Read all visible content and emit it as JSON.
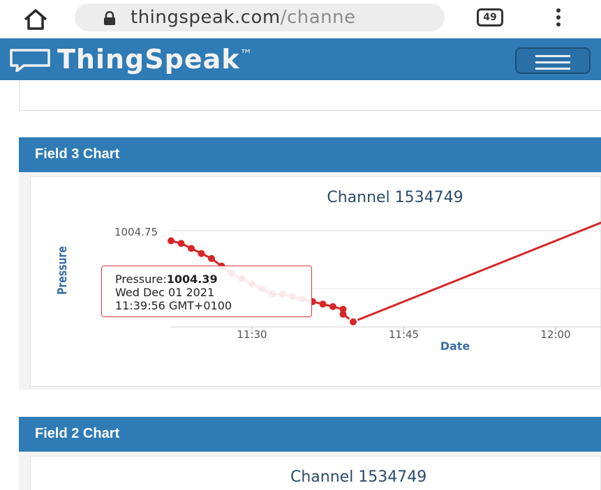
{
  "browser": {
    "url_main": "thingspeak.com",
    "url_rest": "/channe",
    "tab_count": "49"
  },
  "app": {
    "brand": "ThingSpeak",
    "trademark": "™"
  },
  "panels": [
    {
      "header": "Field 3 Chart",
      "chart_title": "Channel 1534749"
    },
    {
      "header": "Field 2 Chart",
      "chart_title": "Channel 1534749"
    }
  ],
  "tooltip": {
    "label": "Pressure:",
    "value": "1004.39",
    "date": "Wed Dec 01 2021",
    "time": "11:39:56 GMT+0100"
  },
  "colors": {
    "brand_blue": "#2f7bb5",
    "series_red": "#d62728",
    "axis_label_blue": "#3b6ea5"
  },
  "chart_data": {
    "type": "line",
    "title": "Channel 1534749",
    "xlabel": "Date",
    "ylabel": "Pressure",
    "y_tick_labels": [
      "1004.75"
    ],
    "x_tick_labels": [
      "11:30",
      "11:45",
      "12:00"
    ],
    "xlim": [
      "11:22",
      "12:06"
    ],
    "ylim": [
      1004.35,
      1004.8
    ],
    "series": [
      {
        "name": "Pressure",
        "x": [
          "11:22",
          "11:23",
          "11:24",
          "11:25",
          "11:26",
          "11:27",
          "11:28",
          "11:29",
          "11:30",
          "11:31",
          "11:32",
          "11:33",
          "11:34",
          "11:35",
          "11:36",
          "11:37",
          "11:38",
          "11:39",
          "11:39",
          "11:40",
          "12:05"
        ],
        "values": [
          1004.71,
          1004.7,
          1004.68,
          1004.66,
          1004.64,
          1004.61,
          1004.58,
          1004.56,
          1004.54,
          1004.52,
          1004.5,
          1004.5,
          1004.49,
          1004.48,
          1004.47,
          1004.46,
          1004.45,
          1004.44,
          1004.42,
          1004.39,
          1004.79
        ]
      }
    ]
  }
}
